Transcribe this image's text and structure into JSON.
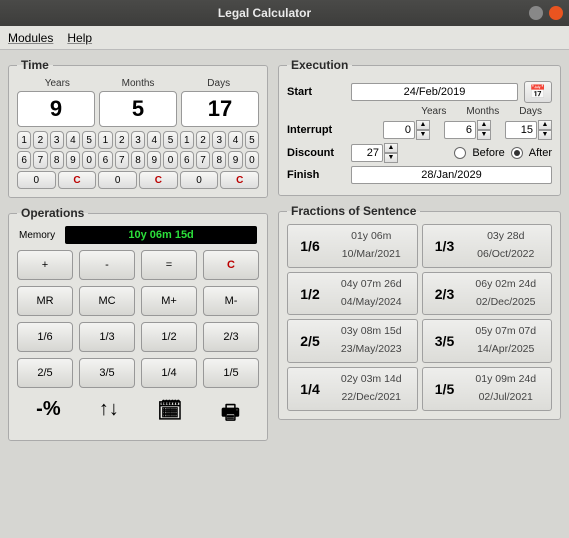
{
  "window": {
    "title": "Legal Calculator"
  },
  "menu": {
    "modules": "Modules",
    "help": "Help"
  },
  "time": {
    "legend": "Time",
    "heads": {
      "years": "Years",
      "months": "Months",
      "days": "Days"
    },
    "values": {
      "years": "9",
      "months": "5",
      "days": "17"
    },
    "clear": "C"
  },
  "ops": {
    "legend": "Operations",
    "memory_label": "Memory",
    "memory_value": "10y 06m 15d",
    "buttons": {
      "add": "+",
      "sub": "-",
      "eq": "=",
      "clr": "C",
      "mr": "MR",
      "mc": "MC",
      "mplus": "M+",
      "mminus": "M-",
      "f16": "1/6",
      "f13": "1/3",
      "f12": "1/2",
      "f23": "2/3",
      "f25": "2/5",
      "f35": "3/5",
      "f14": "1/4",
      "f15": "1/5"
    },
    "tools": {
      "pct": "-%",
      "swap": "↑↓",
      "cal": "🗓",
      "print": "🖶"
    }
  },
  "exec": {
    "legend": "Execution",
    "labels": {
      "start": "Start",
      "interrupt": "Interrupt",
      "discount": "Discount",
      "finish": "Finish",
      "before": "Before",
      "after": "After"
    },
    "heads": {
      "years": "Years",
      "months": "Months",
      "days": "Days"
    },
    "start": "24/Feb/2019",
    "interrupt": {
      "y": "0",
      "m": "6",
      "d": "15"
    },
    "discount": "27",
    "finish": "28/Jan/2029"
  },
  "fractions": {
    "legend": "Fractions of Sentence",
    "items": [
      {
        "label": "1/6",
        "duration": "01y 06m",
        "date": "10/Mar/2021"
      },
      {
        "label": "1/3",
        "duration": "03y 28d",
        "date": "06/Oct/2022"
      },
      {
        "label": "1/2",
        "duration": "04y 07m 26d",
        "date": "04/May/2024"
      },
      {
        "label": "2/3",
        "duration": "06y 02m 24d",
        "date": "02/Dec/2025"
      },
      {
        "label": "2/5",
        "duration": "03y 08m 15d",
        "date": "23/May/2023"
      },
      {
        "label": "3/5",
        "duration": "05y 07m 07d",
        "date": "14/Apr/2025"
      },
      {
        "label": "1/4",
        "duration": "02y 03m 14d",
        "date": "22/Dec/2021"
      },
      {
        "label": "1/5",
        "duration": "01y 09m 24d",
        "date": "02/Jul/2021"
      }
    ]
  }
}
